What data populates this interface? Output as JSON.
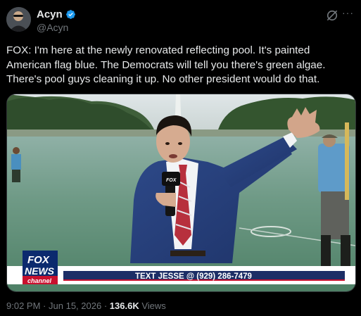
{
  "author": {
    "display_name": "Acyn",
    "handle": "@Acyn",
    "verified": true
  },
  "tweet": {
    "text": "FOX: I'm here at the newly renovated reflecting pool. It's painted\nAmerican flag blue. The Democrats will tell you there's green algae.\nThere's pool guys cleaning it up. No other president would do that."
  },
  "media": {
    "chyron": "TEXT JESSE @ (929) 286-7479",
    "logo_line1": "FOX",
    "logo_line2": "NEWS",
    "logo_line3": "channel"
  },
  "meta": {
    "time": "9:02 PM",
    "separator": "·",
    "date": "Jun 15, 2026",
    "views_count": "136.6K",
    "views_label": "Views"
  },
  "icons": {
    "verified": "verified-badge-icon",
    "grok": "grok-icon",
    "more": "more-icon"
  },
  "colors": {
    "background": "#000000",
    "text": "#e7e9ea",
    "secondary": "#71767b",
    "verified": "#1d9bf0"
  }
}
